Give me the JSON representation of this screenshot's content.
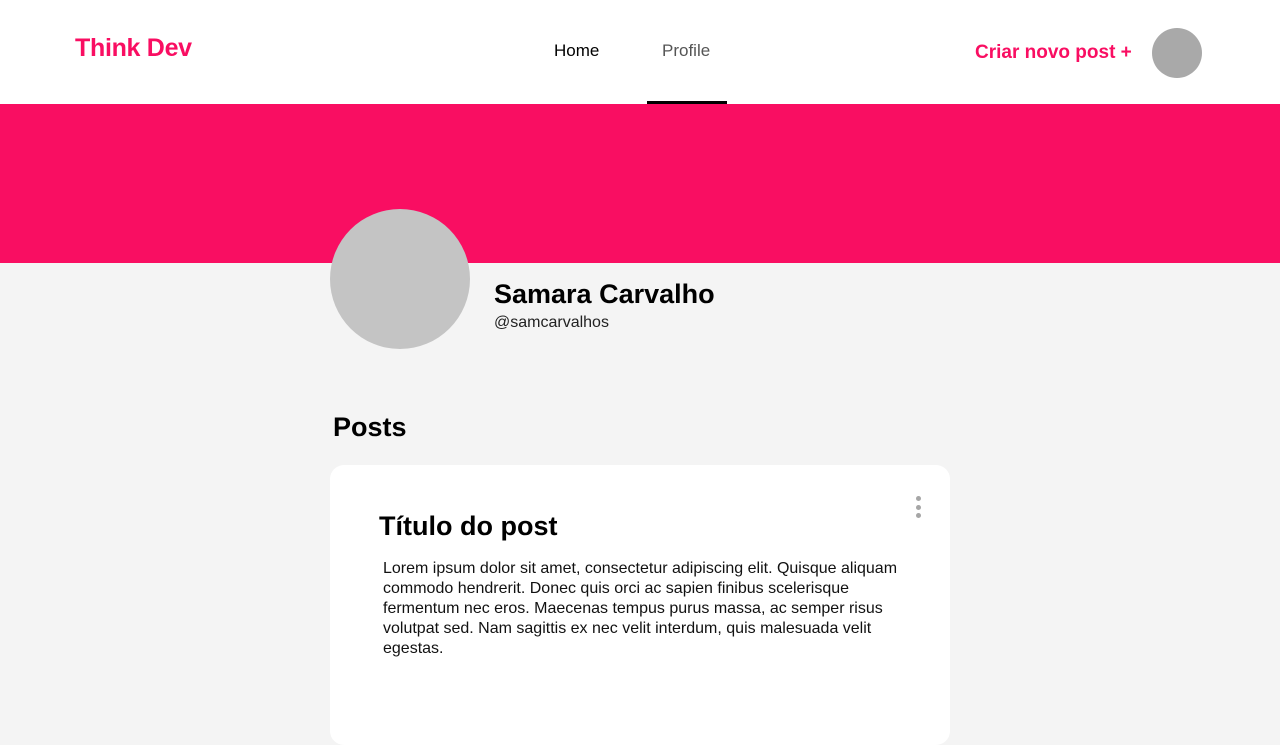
{
  "brand": {
    "name": "Think Dev",
    "accent_color": "#f90e62"
  },
  "nav": {
    "tabs": [
      {
        "label": "Home",
        "active": false
      },
      {
        "label": "Profile",
        "active": true
      }
    ]
  },
  "header": {
    "create_post_label": "Criar novo post +"
  },
  "profile": {
    "name": "Samara Carvalho",
    "handle": "@samcarvalhos"
  },
  "posts": {
    "heading": "Posts",
    "items": [
      {
        "title": "Título do post",
        "body": "Lorem ipsum dolor sit amet, consectetur adipiscing elit. Quisque aliquam commodo hendrerit. Donec quis orci ac sapien finibus scelerisque fermentum nec eros. Maecenas tempus purus massa, ac semper risus volutpat sed. Nam sagittis ex nec velit interdum, quis malesuada velit egestas."
      }
    ]
  }
}
